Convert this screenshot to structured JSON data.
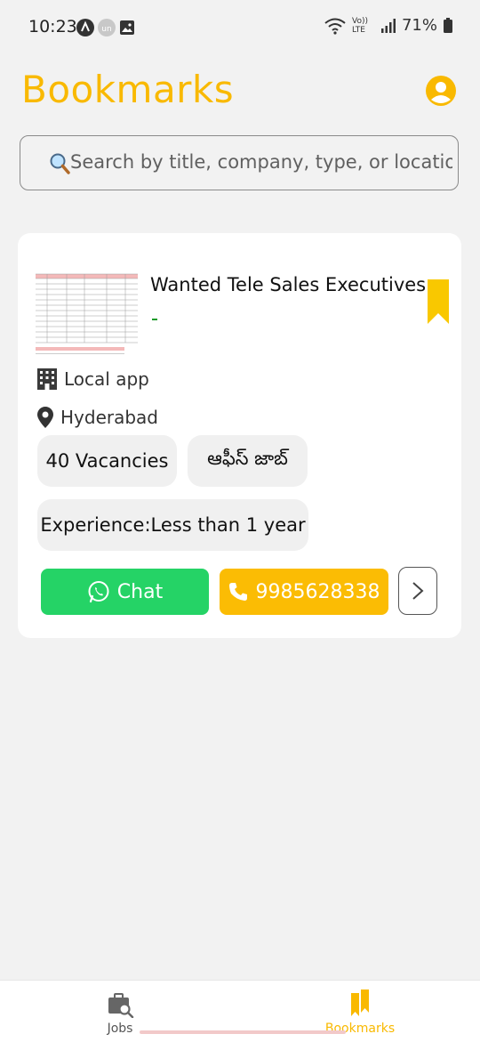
{
  "status_bar": {
    "time": "10:23",
    "battery": "71%",
    "network": "Vo)) LTE"
  },
  "header": {
    "title": "Bookmarks",
    "accent_color": "#f9b900"
  },
  "search": {
    "placeholder": "Search by title, company, type, or location",
    "value": ""
  },
  "job_card": {
    "title": "Wanted Tele Sales Executives",
    "subtitle": "-",
    "company": "Local app",
    "location": "Hyderabad",
    "tags": [
      "40 Vacancies",
      "ఆఫీస్ జాబ్",
      "Experience:Less than 1 year"
    ],
    "chat_label": "Chat",
    "phone": "9985628338",
    "bookmarked": true
  },
  "bottom_nav": {
    "items": [
      {
        "label": "Jobs",
        "icon": "briefcase-search-icon",
        "active": false
      },
      {
        "label": "Bookmarks",
        "icon": "bookmarks-icon",
        "active": true
      }
    ]
  },
  "colors": {
    "chat_green": "#25d366",
    "call_yellow": "#fbbc04",
    "background": "#f2f2f2"
  }
}
